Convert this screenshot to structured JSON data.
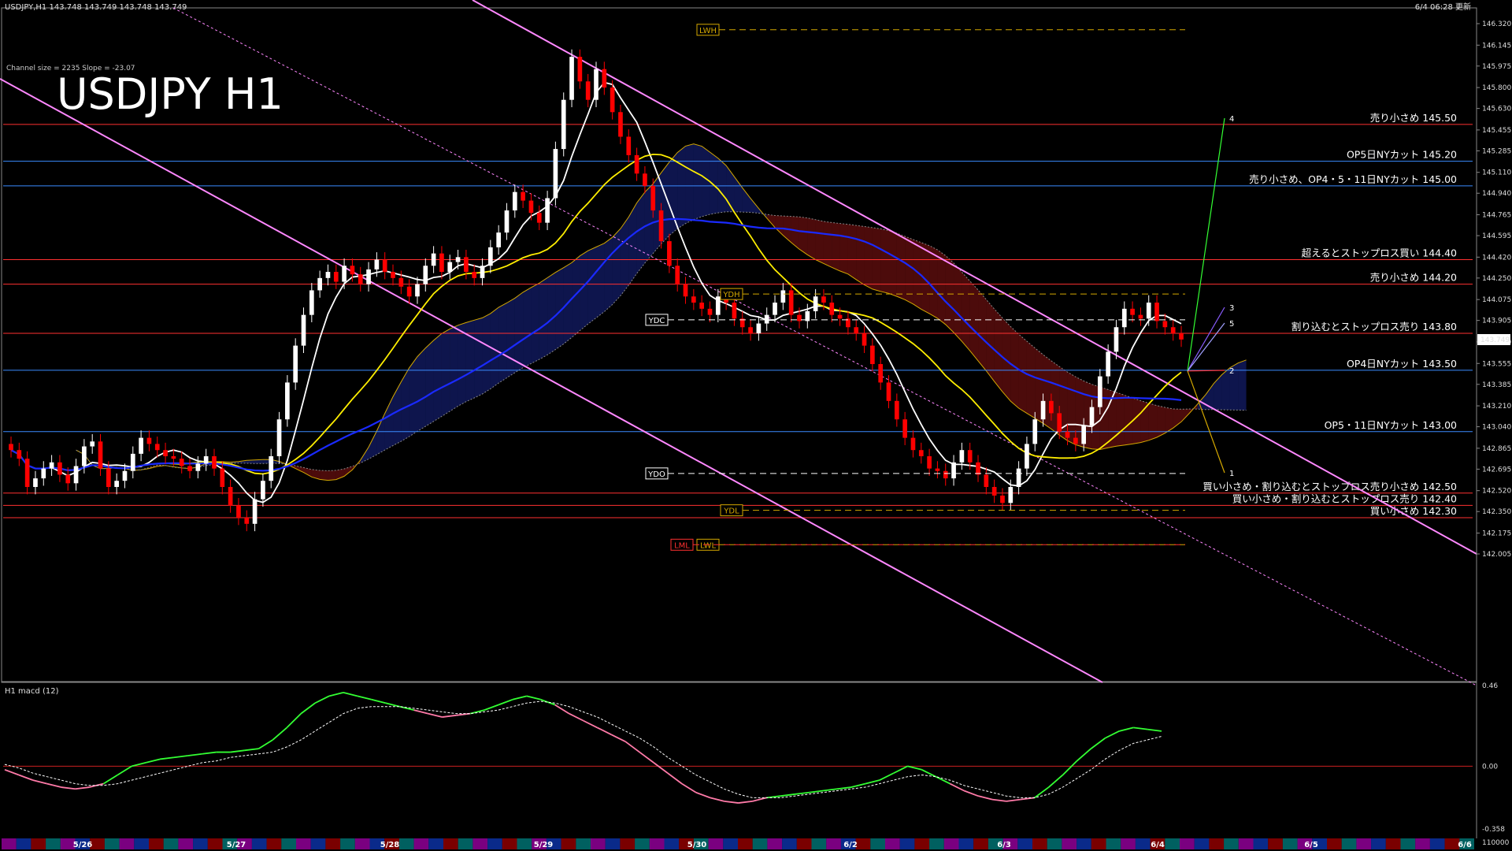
{
  "header": {
    "symbol_info": "USDJPY,H1  143.748 143.749 143.748 143.749",
    "timestamp": "6/4 06:28 更新",
    "channel_info": "Channel size = 2235 Slope = -23.07"
  },
  "title": "USDJPY H1",
  "colors": {
    "background": "#000000",
    "bull_candle": "#ffffff",
    "bear_candle": "#ff0000",
    "resistance_line": "#ff2a2a",
    "support_line": "#3a7bff",
    "ma_fast": "#ffffff",
    "ma_mid": "#ffee00",
    "ma_slow": "#1a2aff",
    "channel": "#ff88ff",
    "macd_main": "#33ff33",
    "macd_signal": "#ffffff"
  },
  "chart_data": {
    "type": "line",
    "symbol": "USDJPY",
    "timeframe": "H1",
    "ylim": [
      142.005,
      146.32
    ],
    "y_ticks": [
      "146.320",
      "146.145",
      "145.975",
      "145.800",
      "145.630",
      "145.455",
      "145.285",
      "145.110",
      "144.940",
      "144.765",
      "144.595",
      "144.420",
      "144.250",
      "144.075",
      "143.905",
      "143.730",
      "143.555",
      "143.385",
      "143.210",
      "143.040",
      "142.865",
      "142.695",
      "142.520",
      "142.350",
      "142.175",
      "142.005"
    ],
    "current_price": "143.749",
    "x_dates": [
      "5/26",
      "5/27",
      "5/28",
      "5/29",
      "5/30",
      "6/2",
      "6/3",
      "6/4",
      "6/5",
      "6/6"
    ],
    "levels": [
      {
        "price": 145.5,
        "label": "売り小さめ 145.50",
        "kind": "resistance"
      },
      {
        "price": 145.2,
        "label": "OP5日NYカット 145.20",
        "kind": "option"
      },
      {
        "price": 145.0,
        "label": "売り小さめ、OP4・5・11日NYカット 145.00",
        "kind": "option"
      },
      {
        "price": 144.4,
        "label": "超えるとストップロス買い 144.40",
        "kind": "resistance"
      },
      {
        "price": 144.2,
        "label": "売り小さめ 144.20",
        "kind": "resistance"
      },
      {
        "price": 143.8,
        "label": "割り込むとストップロス売り 143.80",
        "kind": "support"
      },
      {
        "price": 143.5,
        "label": "OP4日NYカット 143.50",
        "kind": "option"
      },
      {
        "price": 143.0,
        "label": "OP5・11日NYカット 143.00",
        "kind": "option"
      },
      {
        "price": 142.5,
        "label": "買い小さめ・割り込むとストップロス売り小さめ 142.50",
        "kind": "support"
      },
      {
        "price": 142.4,
        "label": "買い小さめ・割り込むとストップロス売り 142.40",
        "kind": "support"
      },
      {
        "price": 142.3,
        "label": "買い小さめ 142.30",
        "kind": "support"
      }
    ],
    "markers": [
      {
        "label": "LWH",
        "price": 146.27
      },
      {
        "label": "YDH",
        "price": 144.12
      },
      {
        "label": "YDC",
        "price": 143.91
      },
      {
        "label": "YDO",
        "price": 142.66
      },
      {
        "label": "YDL",
        "price": 142.36
      },
      {
        "label": "LWL",
        "price": 142.08
      },
      {
        "label": "LML",
        "price": 142.08
      }
    ],
    "projection_labels": [
      "1",
      "2",
      "3",
      "4",
      "5"
    ],
    "close": [
      142.85,
      142.78,
      142.55,
      142.62,
      142.7,
      142.75,
      142.65,
      142.58,
      142.72,
      142.88,
      142.92,
      142.7,
      142.55,
      142.6,
      142.68,
      142.82,
      142.95,
      142.9,
      142.85,
      142.8,
      142.78,
      142.72,
      142.68,
      142.74,
      142.8,
      142.7,
      142.55,
      142.4,
      142.3,
      142.25,
      142.45,
      142.6,
      142.8,
      143.1,
      143.4,
      143.7,
      143.95,
      144.15,
      144.25,
      144.3,
      144.22,
      144.35,
      144.28,
      144.2,
      144.32,
      144.4,
      144.3,
      144.25,
      144.18,
      144.1,
      144.2,
      144.35,
      144.45,
      144.3,
      144.38,
      144.42,
      144.3,
      144.25,
      144.35,
      144.5,
      144.62,
      144.8,
      144.95,
      144.88,
      144.78,
      144.7,
      144.9,
      145.3,
      145.7,
      146.05,
      145.85,
      145.7,
      145.95,
      145.8,
      145.6,
      145.4,
      145.25,
      145.1,
      145.0,
      144.8,
      144.55,
      144.35,
      144.2,
      144.1,
      144.05,
      144.0,
      143.95,
      144.1,
      144.05,
      143.92,
      143.85,
      143.8,
      143.88,
      143.95,
      144.05,
      144.15,
      143.95,
      143.9,
      143.98,
      144.1,
      144.05,
      143.95,
      143.92,
      143.85,
      143.8,
      143.7,
      143.55,
      143.4,
      143.25,
      143.1,
      142.95,
      142.85,
      142.8,
      142.7,
      142.68,
      142.62,
      142.75,
      142.85,
      142.75,
      142.65,
      142.55,
      142.48,
      142.42,
      142.55,
      142.7,
      142.9,
      143.1,
      143.25,
      143.15,
      143.0,
      142.95,
      142.9,
      143.05,
      143.2,
      143.45,
      143.65,
      143.85,
      144.0,
      143.95,
      143.92,
      144.05,
      143.9,
      143.85,
      143.8,
      143.75
    ]
  },
  "macd_panel": {
    "label": "H1 macd (12)",
    "y_ticks": [
      "0.46",
      "0.00",
      "-0.358"
    ],
    "ylim": [
      -0.358,
      0.46
    ],
    "bottom_value": "110000",
    "main": [
      -0.02,
      -0.05,
      -0.08,
      -0.1,
      -0.12,
      -0.13,
      -0.12,
      -0.1,
      -0.05,
      0,
      0.02,
      0.04,
      0.05,
      0.06,
      0.07,
      0.08,
      0.08,
      0.09,
      0.1,
      0.15,
      0.22,
      0.3,
      0.36,
      0.4,
      0.42,
      0.4,
      0.38,
      0.36,
      0.34,
      0.32,
      0.3,
      0.28,
      0.29,
      0.3,
      0.32,
      0.35,
      0.38,
      0.4,
      0.38,
      0.35,
      0.3,
      0.26,
      0.22,
      0.18,
      0.14,
      0.08,
      0.02,
      -0.04,
      -0.1,
      -0.15,
      -0.18,
      -0.2,
      -0.21,
      -0.2,
      -0.18,
      -0.17,
      -0.16,
      -0.15,
      -0.14,
      -0.13,
      -0.12,
      -0.1,
      -0.08,
      -0.04,
      0,
      -0.02,
      -0.06,
      -0.1,
      -0.14,
      -0.17,
      -0.19,
      -0.2,
      -0.19,
      -0.18,
      -0.12,
      -0.05,
      0.03,
      0.1,
      0.16,
      0.2,
      0.22,
      0.21,
      0.2
    ],
    "signal": [
      0.01,
      -0.01,
      -0.04,
      -0.06,
      -0.08,
      -0.1,
      -0.11,
      -0.11,
      -0.1,
      -0.08,
      -0.06,
      -0.04,
      -0.02,
      0,
      0.02,
      0.03,
      0.05,
      0.06,
      0.07,
      0.08,
      0.11,
      0.15,
      0.2,
      0.25,
      0.3,
      0.33,
      0.34,
      0.34,
      0.34,
      0.33,
      0.32,
      0.31,
      0.3,
      0.3,
      0.31,
      0.32,
      0.34,
      0.36,
      0.37,
      0.36,
      0.34,
      0.31,
      0.28,
      0.24,
      0.2,
      0.16,
      0.11,
      0.05,
      0,
      -0.05,
      -0.09,
      -0.13,
      -0.16,
      -0.18,
      -0.18,
      -0.18,
      -0.17,
      -0.16,
      -0.15,
      -0.14,
      -0.13,
      -0.12,
      -0.1,
      -0.08,
      -0.06,
      -0.05,
      -0.06,
      -0.08,
      -0.11,
      -0.13,
      -0.15,
      -0.17,
      -0.18,
      -0.18,
      -0.16,
      -0.12,
      -0.07,
      -0.02,
      0.04,
      0.09,
      0.13,
      0.15,
      0.17
    ]
  }
}
